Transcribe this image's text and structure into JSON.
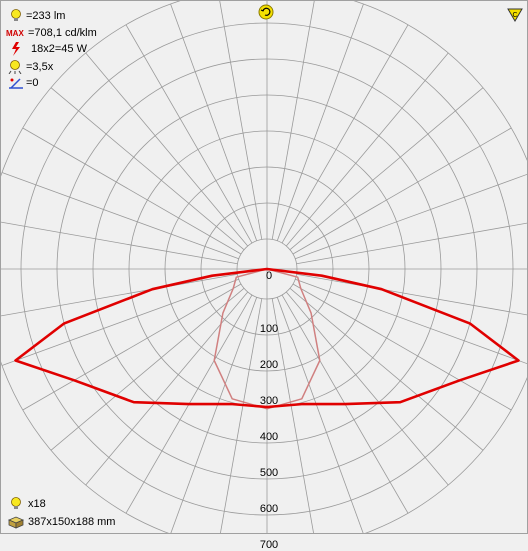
{
  "info": {
    "flux": "=233 lm",
    "max_intensity": "=708,1 cd/klm",
    "lamp": "18x2=45 W",
    "factor": "=3,5x",
    "angle": "=0"
  },
  "footer": {
    "count": "x18",
    "dimensions": "387x150x188 mm"
  },
  "icons": {
    "flux": "bulb-icon",
    "max": "max-icon",
    "lamp": "lightning-icon",
    "factor": "bulb-rays-icon",
    "angle": "angle-icon",
    "top": "rotate-icon",
    "corner": "corner-icon",
    "count": "bulb-icon",
    "dimensions": "box-icon"
  },
  "colors": {
    "curve_c0": "#e00000",
    "curve_c90": "#d08080",
    "grid": "#9a9a9a",
    "background": "#f0f0f0"
  },
  "chart_data": {
    "type": "polar",
    "radial_ticks": [
      "0",
      "100",
      "200",
      "300",
      "400",
      "500",
      "600",
      "700"
    ],
    "radial_values": [
      0,
      100,
      200,
      300,
      400,
      500,
      600,
      700
    ],
    "angle_step_deg": 10,
    "series": [
      {
        "style": "thick-red",
        "angle_deg": [
          -180,
          -150,
          -120,
          -105,
          -90,
          -83,
          -80,
          -75,
          -70,
          -60,
          -45,
          -30,
          -15,
          0,
          15,
          30,
          45,
          60,
          70,
          75,
          80,
          83,
          90,
          105,
          120,
          150,
          180
        ],
        "intensity": [
          0,
          0,
          0,
          0,
          0,
          70,
          240,
          500,
          660,
          535,
          440,
          350,
          305,
          300,
          305,
          350,
          440,
          535,
          660,
          500,
          240,
          70,
          0,
          0,
          0,
          0,
          0
        ]
      },
      {
        "style": "thin-pink",
        "angle_deg": [
          -90,
          -75,
          -60,
          -45,
          -30,
          -15,
          0,
          15,
          30,
          45,
          60,
          75,
          90
        ],
        "intensity": [
          0,
          5,
          25,
          90,
          210,
          290,
          305,
          290,
          210,
          90,
          25,
          5,
          0
        ]
      }
    ]
  }
}
